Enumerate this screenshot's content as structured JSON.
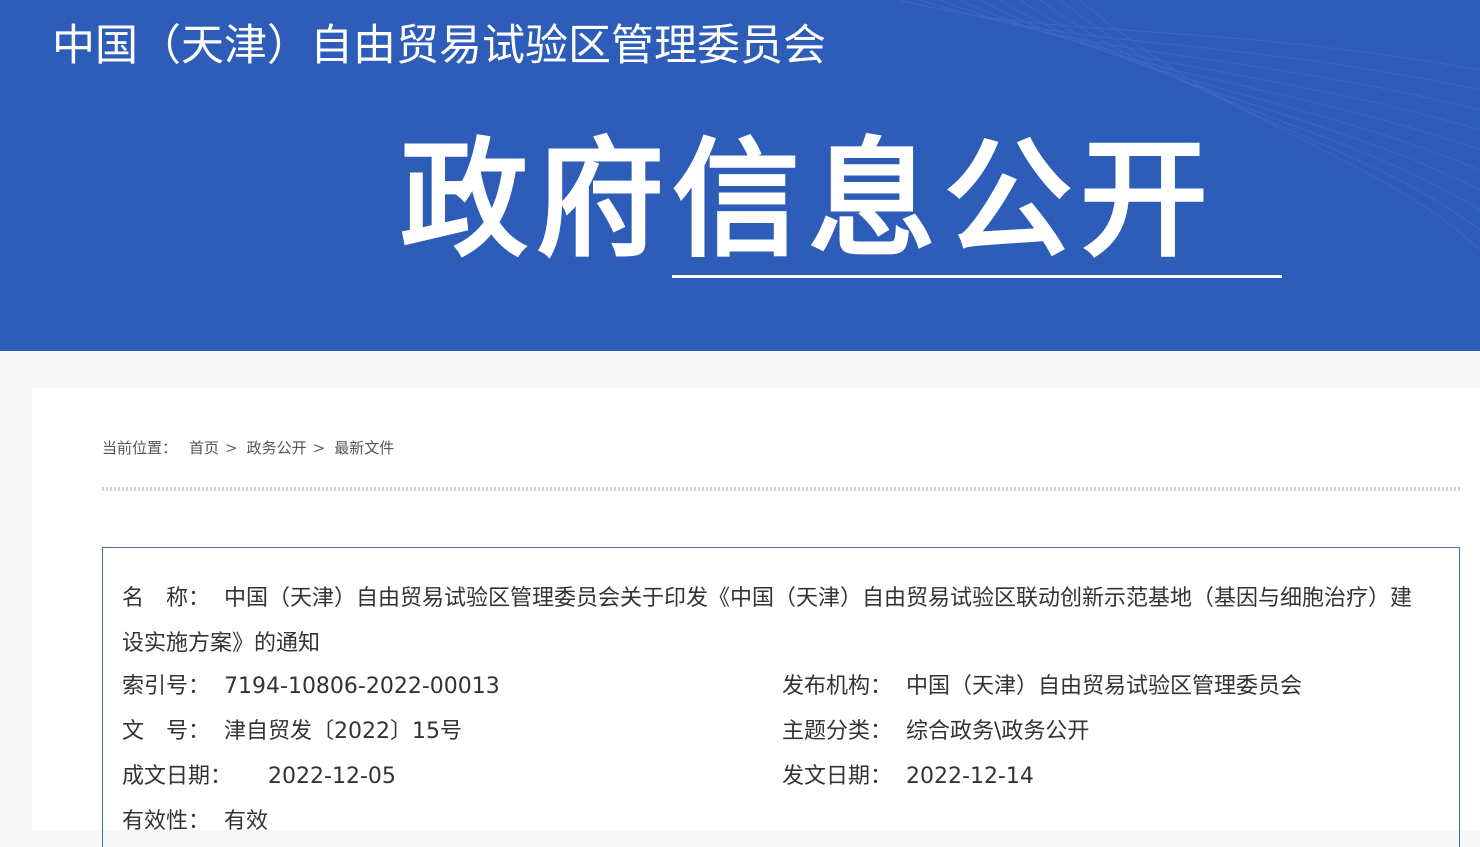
{
  "header": {
    "site_title": "中国（天津）自由贸易试验区管理委员会",
    "section_title": "政府信息公开",
    "background_color": "#2d5cb9"
  },
  "breadcrumb": {
    "lead": "当前位置：",
    "items": [
      "首页",
      "政务公开",
      "最新文件"
    ],
    "separator": ">"
  },
  "document_info": {
    "name_label": "名　称：",
    "name_value": "中国（天津）自由贸易试验区管理委员会关于印发《中国（天津）自由贸易试验区联动创新示范基地（基因与细胞治疗）建设实施方案》的通知",
    "index_label": "索引号：",
    "index_value": "7194-10806-2022-00013",
    "publisher_label": "发布机构：",
    "publisher_value": "中国（天津）自由贸易试验区管理委员会",
    "doc_no_label": "文　号：",
    "doc_no_value": "津自贸发〔2022〕15号",
    "topic_label": "主题分类：",
    "topic_value": "综合政务\\政务公开",
    "written_date_label": "成文日期：",
    "written_date_value": "2022-12-05",
    "issue_date_label": "发文日期：",
    "issue_date_value": "2022-12-14",
    "validity_label": "有效性：",
    "validity_value": "有效"
  }
}
